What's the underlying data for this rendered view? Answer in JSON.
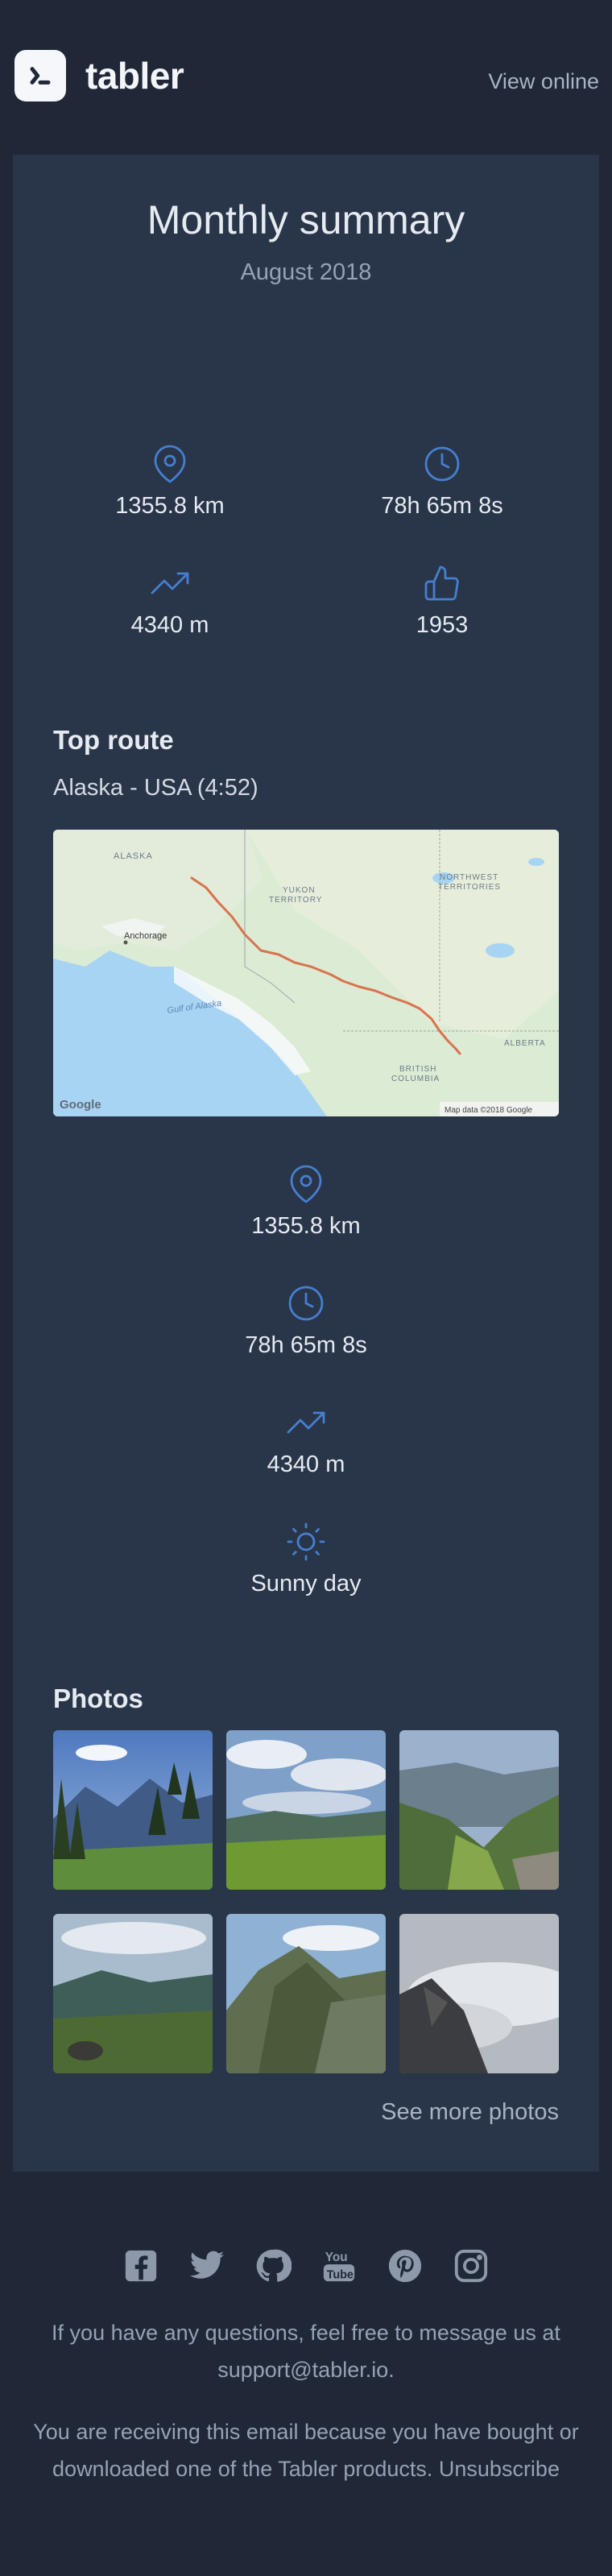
{
  "header": {
    "brand": "tabler",
    "view_online": "View online"
  },
  "summary": {
    "title": "Monthly summary",
    "period": "August 2018"
  },
  "monthly_stats": {
    "distance": "1355.8 km",
    "time": "78h 65m 8s",
    "elevation": "4340 m",
    "likes": "1953"
  },
  "top_route": {
    "heading": "Top route",
    "name": "Alaska - USA (4:52)",
    "map": {
      "labels": {
        "alaska": "ALASKA",
        "yukon": "YUKON",
        "territory": "TERRITORY",
        "northwest": "NORTHWEST",
        "territories": "TERRITORIES",
        "anchorage": "Anchorage",
        "gulf": "Gulf of Alaska",
        "alberta": "ALBERTA",
        "british": "BRITISH",
        "columbia": "COLUMBIA",
        "google": "Google",
        "attribution": "Map data ©2018 Google"
      }
    },
    "stats": {
      "distance": "1355.8 km",
      "time": "78h 65m 8s",
      "elevation": "4340 m",
      "weather": "Sunny day"
    }
  },
  "photos": {
    "heading": "Photos",
    "see_more": "See more photos"
  },
  "footer": {
    "questions_prefix": "If you have any questions, feel free to message us at",
    "support_email": "support@tabler.io.",
    "receiving_text": "You are receiving this email because you have bought or downloaded one of the Tabler products.",
    "unsubscribe": "Unsubscribe"
  },
  "colors": {
    "background": "#202736",
    "card": "#293548",
    "accent": "#467fcf",
    "route": "#d9734e"
  },
  "icons": [
    "map-pin-icon",
    "clock-icon",
    "trending-up-icon",
    "thumbs-up-icon",
    "sun-icon",
    "facebook-icon",
    "twitter-icon",
    "github-icon",
    "youtube-icon",
    "pinterest-icon",
    "instagram-icon"
  ]
}
